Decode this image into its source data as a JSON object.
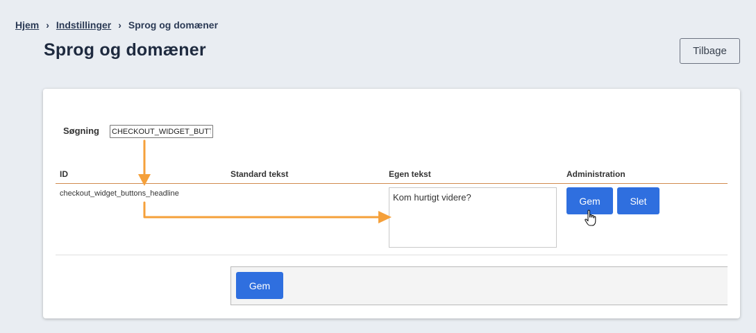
{
  "breadcrumb": {
    "home": "Hjem",
    "settings": "Indstillinger",
    "current": "Sprog og domæner",
    "separator": "›"
  },
  "page": {
    "title": "Sprog og domæner",
    "back_label": "Tilbage"
  },
  "search": {
    "label": "Søgning",
    "value": "CHECKOUT_WIDGET_BUTTONS_HEADLINE"
  },
  "table": {
    "columns": [
      "ID",
      "Standard tekst",
      "Egen tekst",
      "Administration"
    ],
    "rows": [
      {
        "id": "checkout_widget_buttons_headline",
        "standard_text": "",
        "own_text": "Kom hurtigt videre?",
        "save_label": "Gem",
        "delete_label": "Slet"
      }
    ]
  },
  "footer": {
    "save_label": "Gem"
  },
  "colors": {
    "primary_button": "#2f6fdf",
    "annotation_arrow": "#f5a03a",
    "header_line": "#d08a4c"
  },
  "icons": [
    "hand-pointer-cursor-icon"
  ]
}
